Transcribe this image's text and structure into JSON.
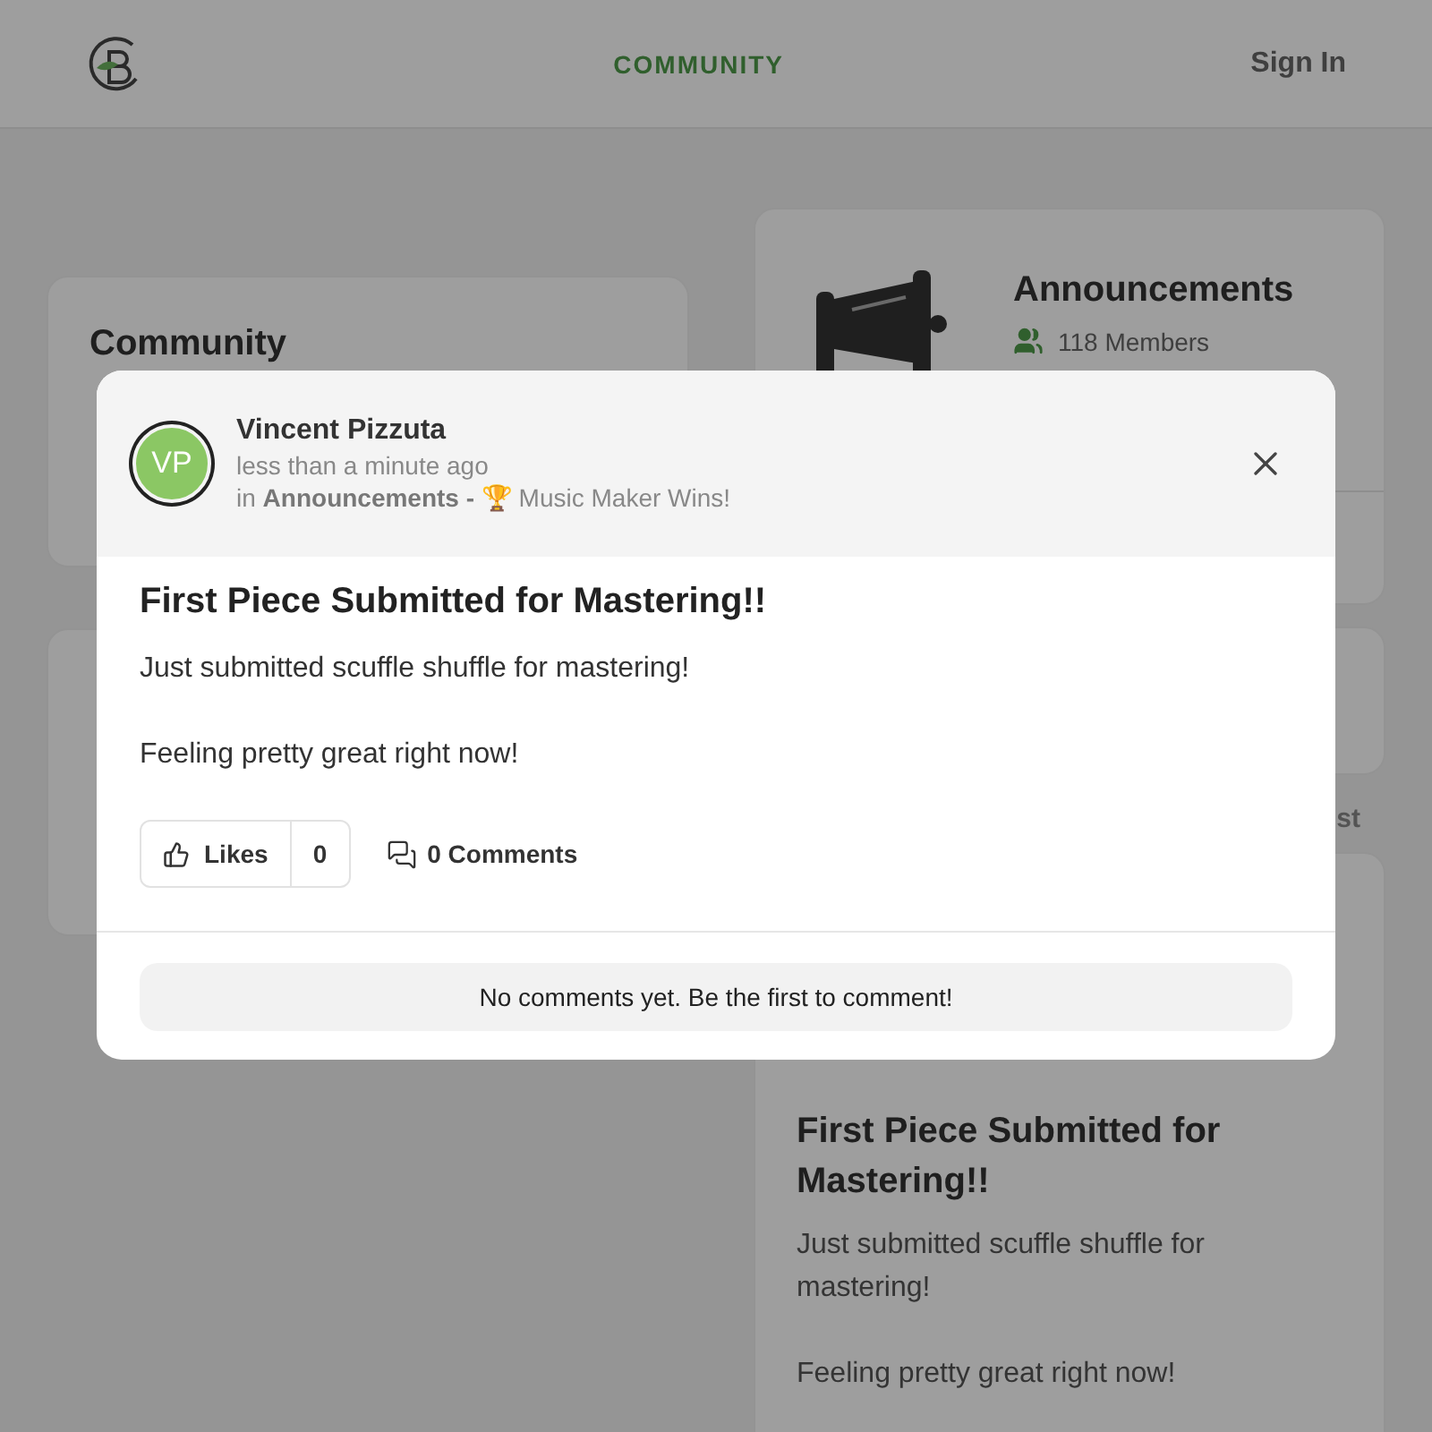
{
  "header": {
    "nav": [
      {
        "label": "COMMUNITY",
        "selected": true
      }
    ],
    "sign_in": "Sign In"
  },
  "background": {
    "left_cards": [
      {
        "title": "Community"
      }
    ],
    "announcements": {
      "title": "Announcements",
      "members": "118 Members"
    },
    "feed_tab": "st",
    "post": {
      "title": "First Piece Submitted for Mastering!!",
      "paragraphs": [
        "Just submitted scuffle shuffle for mastering!",
        "Feeling pretty great right now!"
      ]
    }
  },
  "modal": {
    "author": {
      "initials": "VP",
      "name": "Vincent Pizzuta"
    },
    "time": "less than a minute ago",
    "location": "in **Announcements -** 🏆 Music Maker Wins!",
    "title": "First Piece Submitted for Mastering!!",
    "paragraphs": [
      "Just submitted scuffle shuffle for mastering!",
      "Feeling pretty great right now!"
    ],
    "likes": {
      "label": "Likes",
      "count": "0"
    },
    "comments": "0 Comments",
    "empty_comments": "No comments yet. Be the first to comment!"
  }
}
